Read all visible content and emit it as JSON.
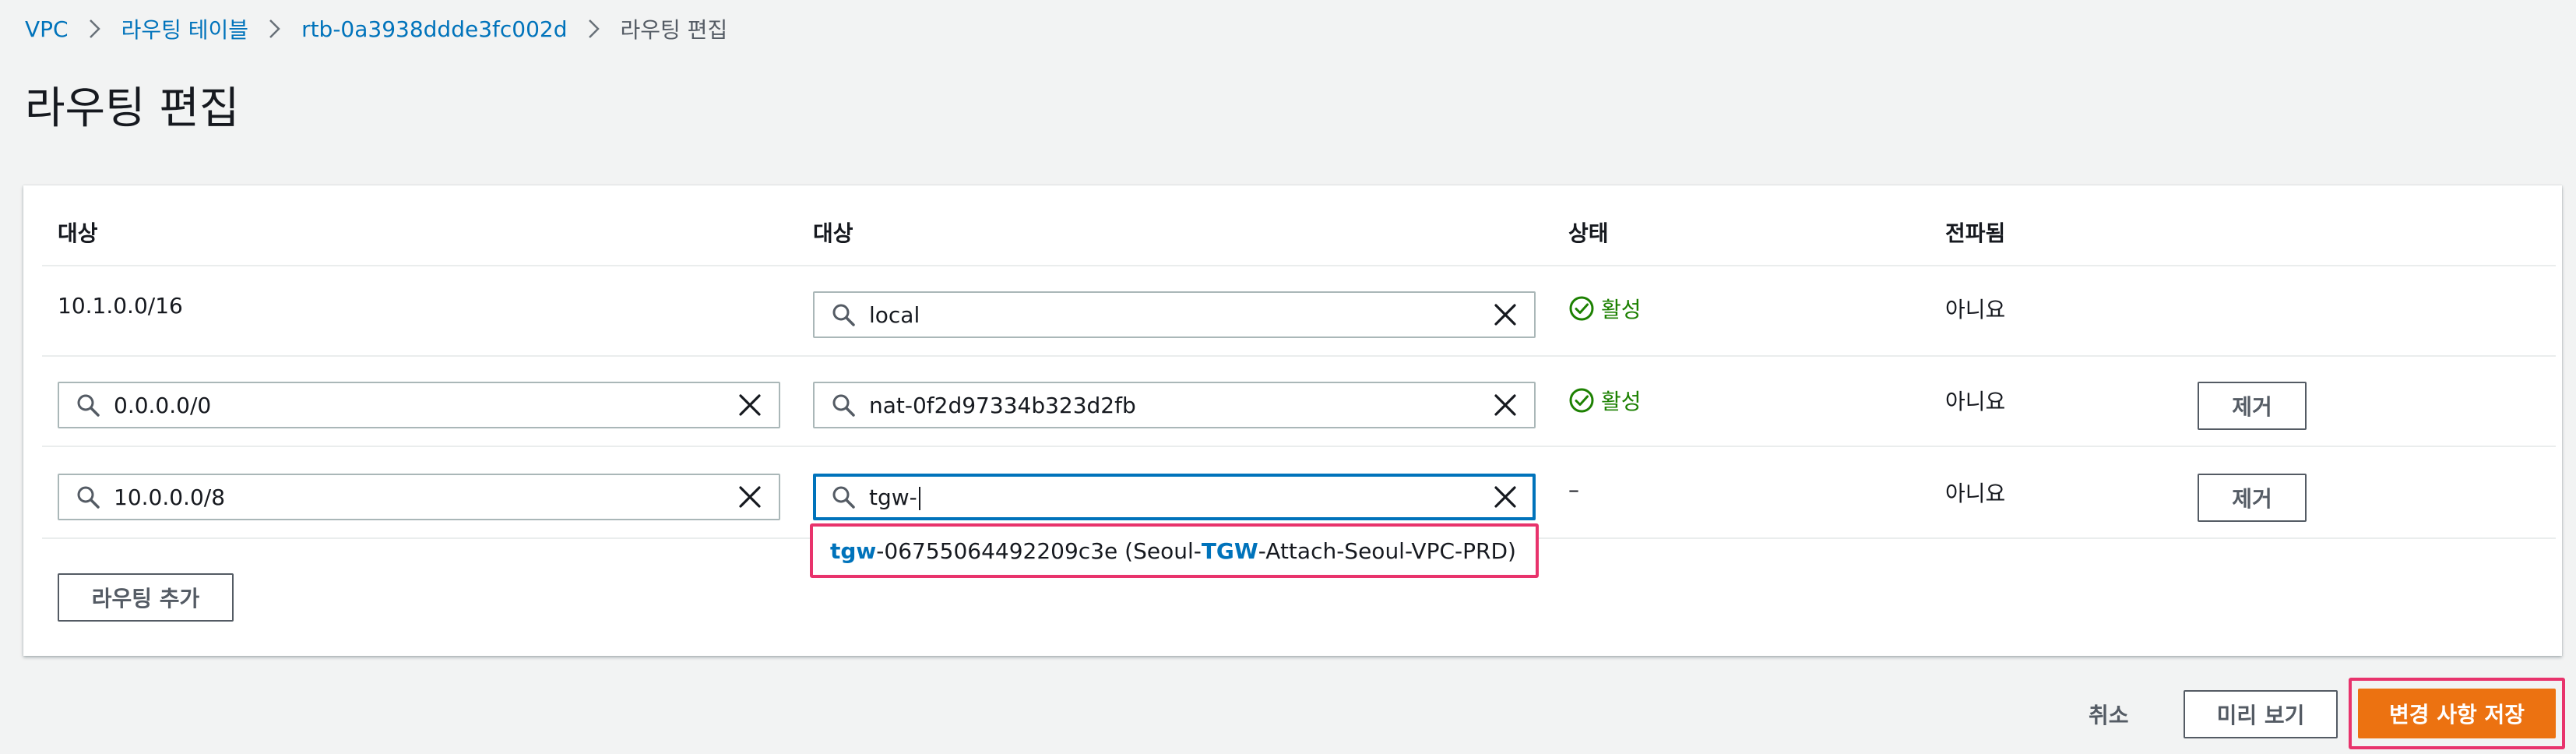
{
  "breadcrumb": {
    "items": [
      "VPC",
      "라우팅 테이블",
      "rtb-0a3938ddde3fc002d"
    ],
    "current": "라우팅 편집"
  },
  "page": {
    "title": "라우팅 편집"
  },
  "table": {
    "headers": [
      "대상",
      "대상",
      "상태",
      "전파됨"
    ],
    "rows": [
      {
        "destination": "10.1.0.0/16",
        "target": "local",
        "status": "활성",
        "propagated": "아니요"
      },
      {
        "destination": "0.0.0.0/0",
        "target": "nat-0f2d97334b323d2fb",
        "status": "활성",
        "propagated": "아니요",
        "remove_label": "제거"
      },
      {
        "destination": "10.0.0.0/8",
        "target": "tgw-",
        "status": "–",
        "propagated": "아니요",
        "remove_label": "제거"
      }
    ],
    "dropdown": {
      "prefix": "tgw",
      "id_rest": "-06755064492209c3e (Seoul-",
      "name_hl": "TGW",
      "name_rest": "-Attach-Seoul-VPC-PRD)"
    },
    "add_route_label": "라우팅 추가"
  },
  "footer": {
    "cancel_label": "취소",
    "preview_label": "미리 보기",
    "save_label": "변경 사항 저장"
  },
  "colors": {
    "link": "#0073bb",
    "success": "#1d8102",
    "primary": "#ec7211",
    "highlight_border": "#e8336c"
  },
  "icons": [
    "search-icon",
    "clear-icon",
    "check-circle-icon",
    "chevron-right-icon"
  ]
}
